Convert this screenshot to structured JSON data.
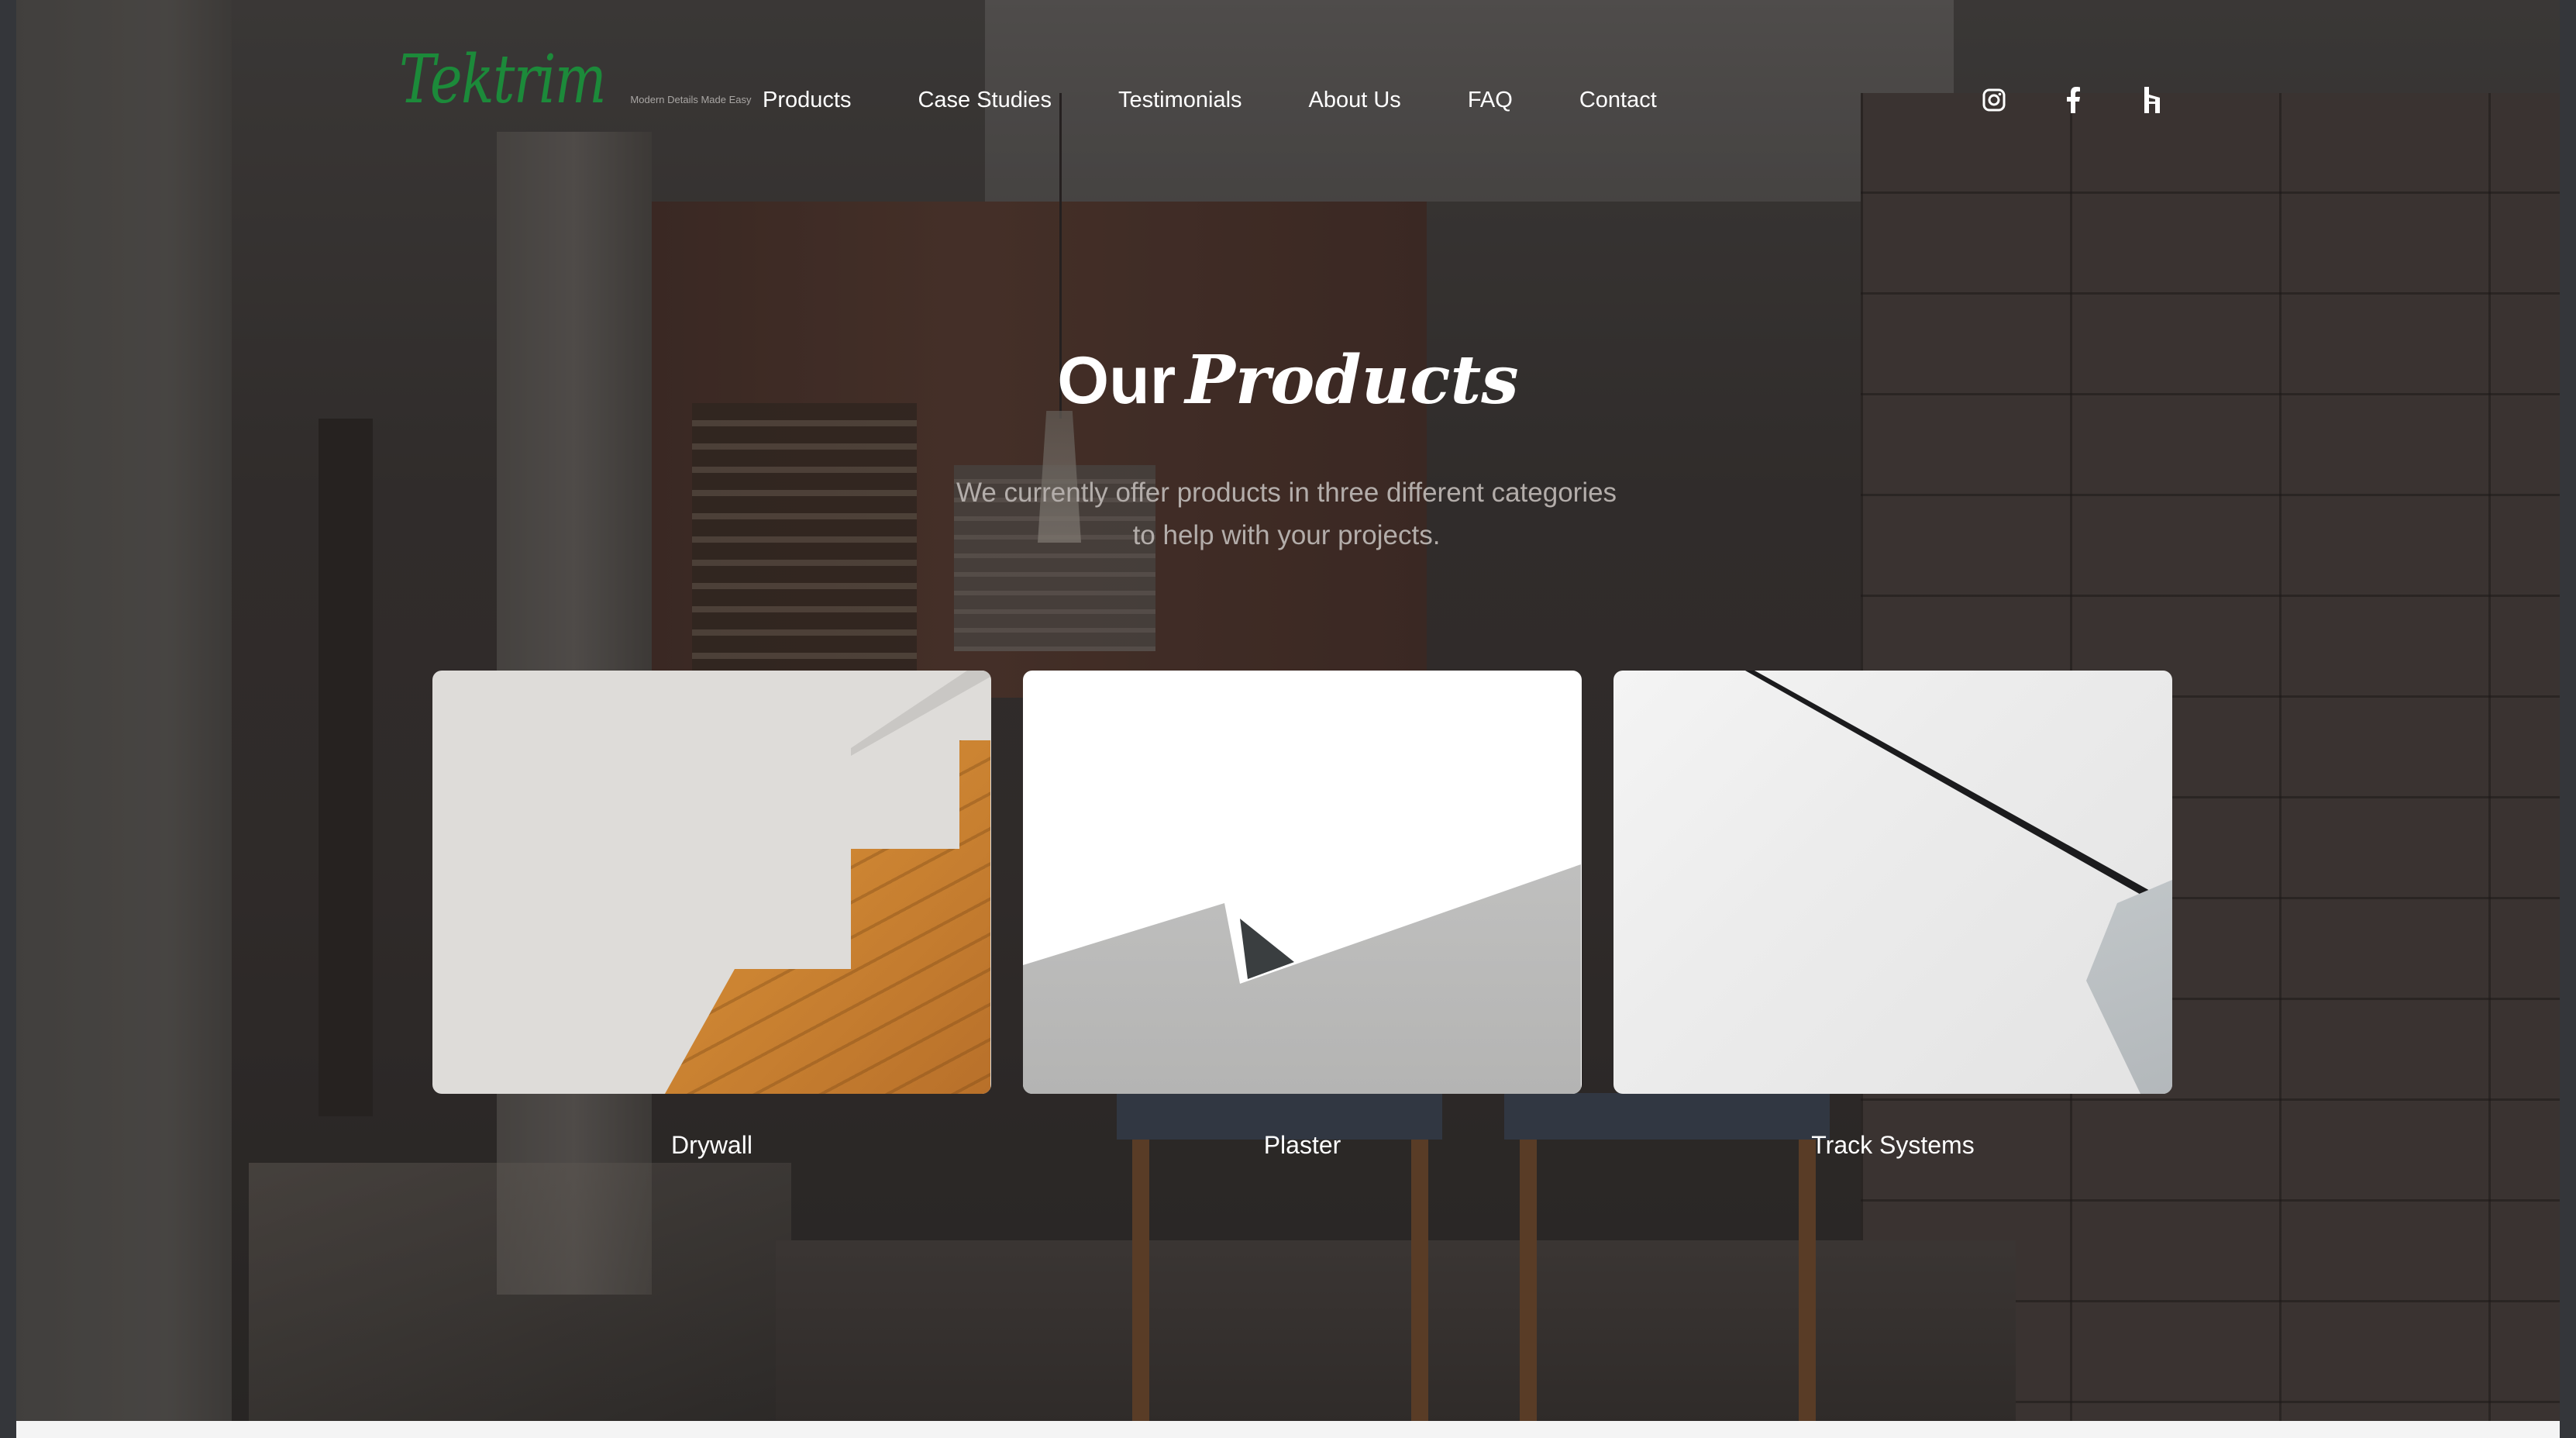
{
  "brand": {
    "name": "Tektrim",
    "tagline": "Modern Details Made Easy",
    "logo_color": "#1c8a3a"
  },
  "nav": {
    "items": [
      {
        "label": "Products"
      },
      {
        "label": "Case Studies"
      },
      {
        "label": "Testimonials"
      },
      {
        "label": "About Us"
      },
      {
        "label": "FAQ"
      },
      {
        "label": "Contact"
      }
    ]
  },
  "social": {
    "icons": [
      "instagram-icon",
      "facebook-icon",
      "houzz-icon"
    ]
  },
  "hero": {
    "title_part1": "Our",
    "title_part2": "Products",
    "subtitle": "We currently offer products in three different categories to help with your projects."
  },
  "products": [
    {
      "label": "Drywall",
      "image": "drywall-stair-trim"
    },
    {
      "label": "Plaster",
      "image": "plaster-reveal"
    },
    {
      "label": "Track Systems",
      "image": "track-ceiling"
    }
  ],
  "colors": {
    "text": "#ffffff",
    "subtitle": "#b3adaa"
  }
}
